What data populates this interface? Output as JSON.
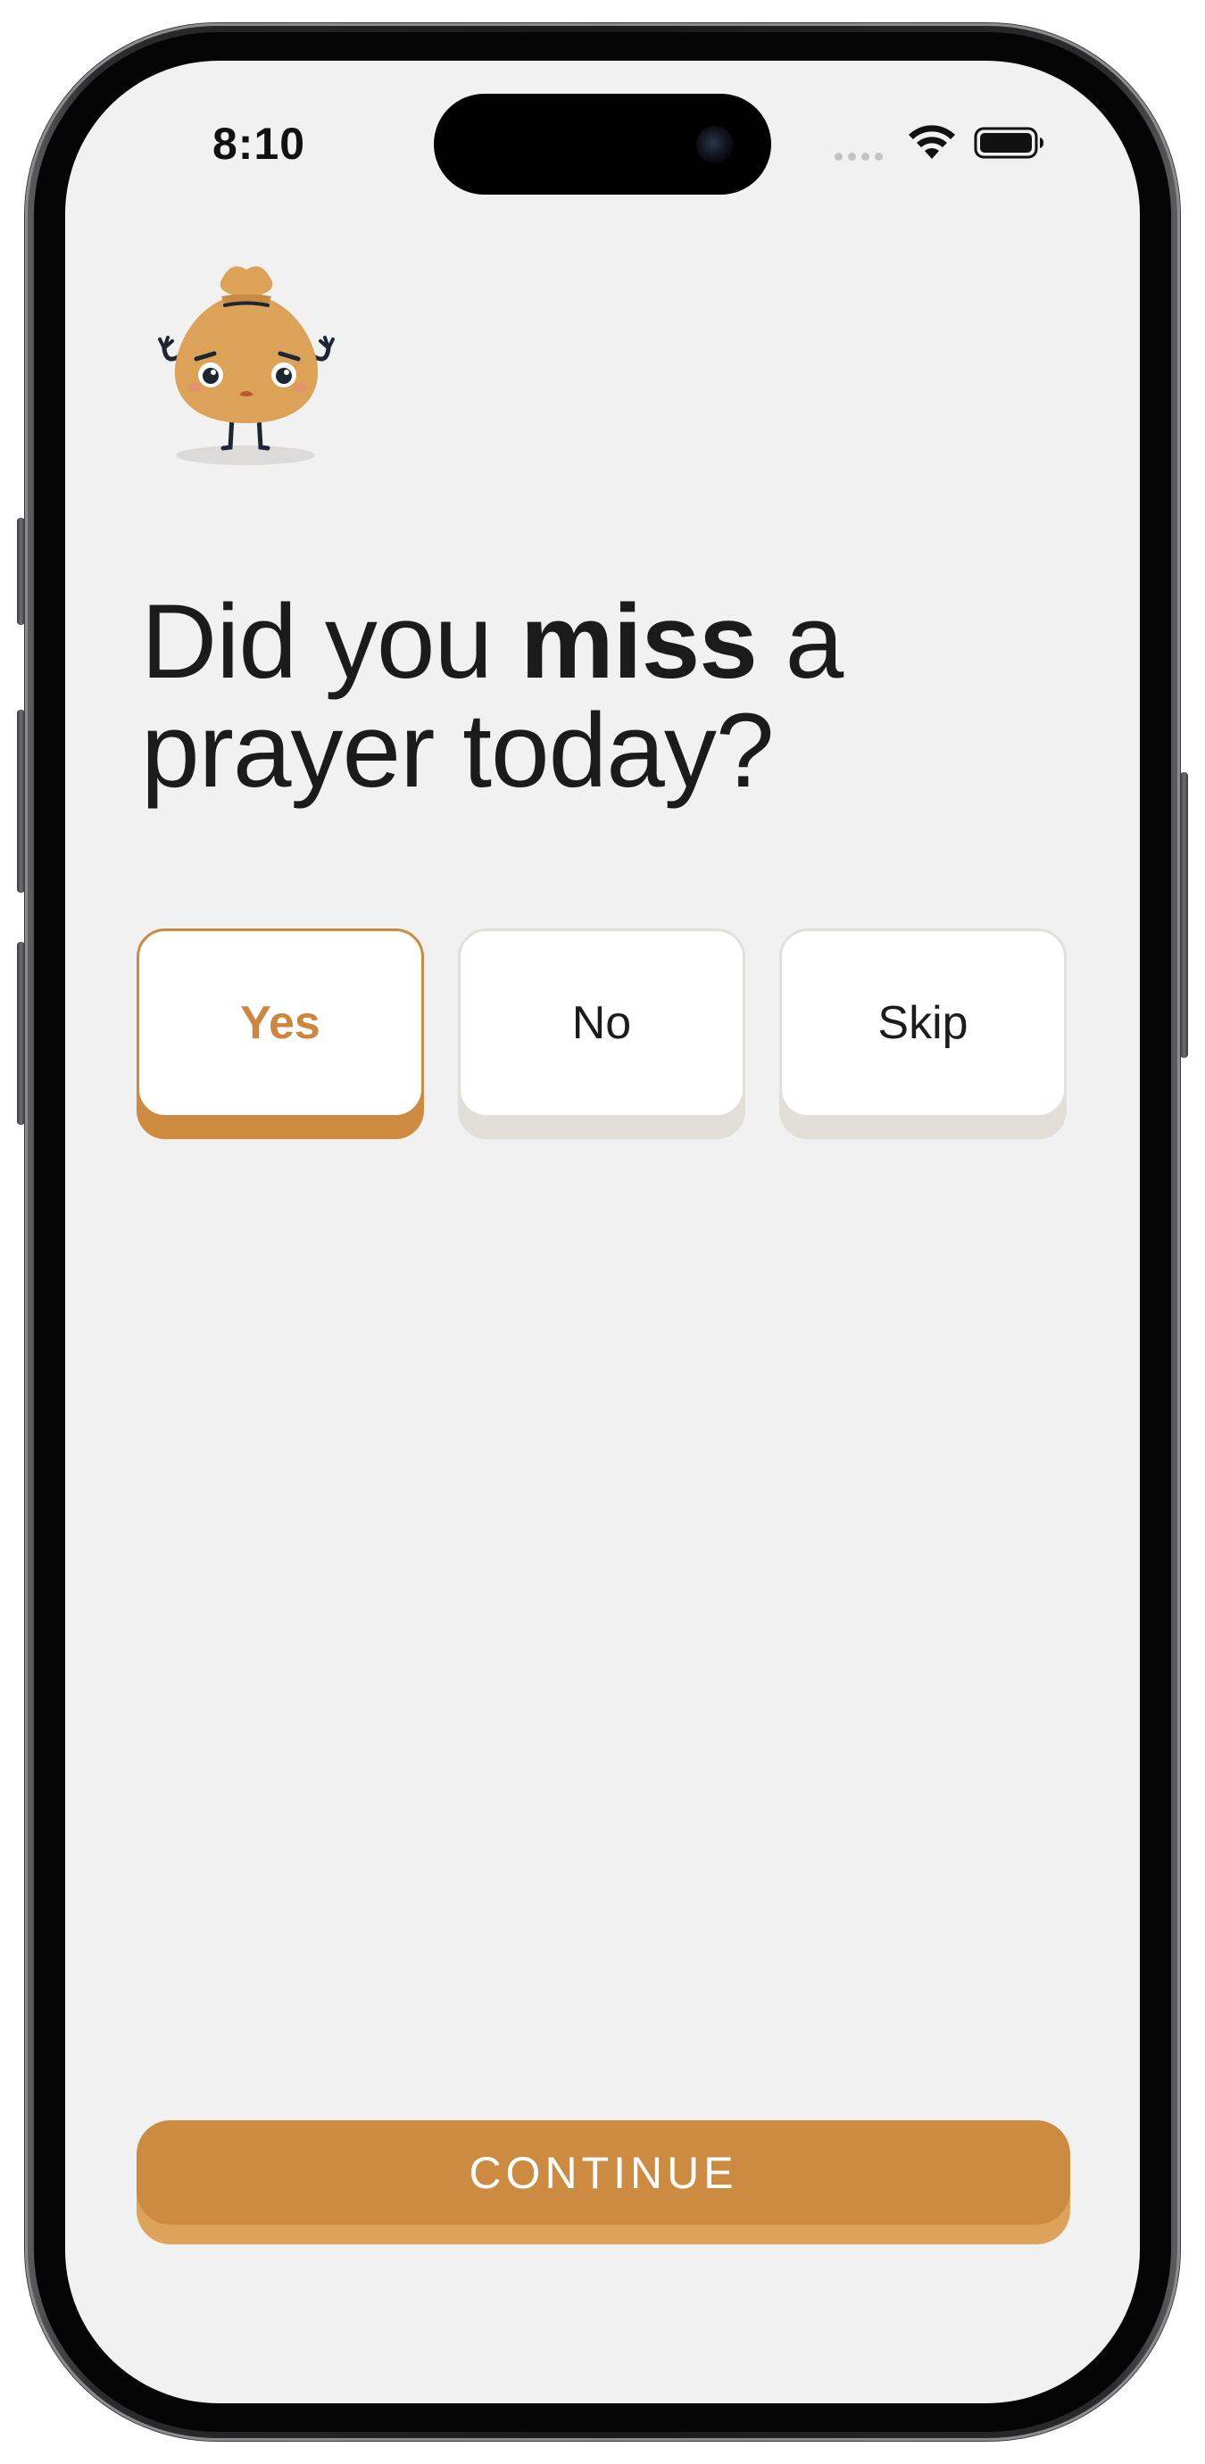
{
  "status_bar": {
    "time": "8:10"
  },
  "question": {
    "part1": "Did you ",
    "bold": "miss",
    "part2": " a prayer today?"
  },
  "options": [
    {
      "label": "Yes",
      "selected": true
    },
    {
      "label": "No",
      "selected": false
    },
    {
      "label": "Skip",
      "selected": false
    }
  ],
  "continue_label": "CONTINUE",
  "colors": {
    "accent": "#cd8b42",
    "accent_shadow": "#dea35b",
    "background": "#f1f1f1",
    "mascot_body": "#dca258"
  },
  "icons": {
    "mascot": "worried-money-bag-mascot",
    "wifi": "wifi-icon",
    "battery": "battery-icon",
    "cellular": "cellular-signal-icon"
  }
}
